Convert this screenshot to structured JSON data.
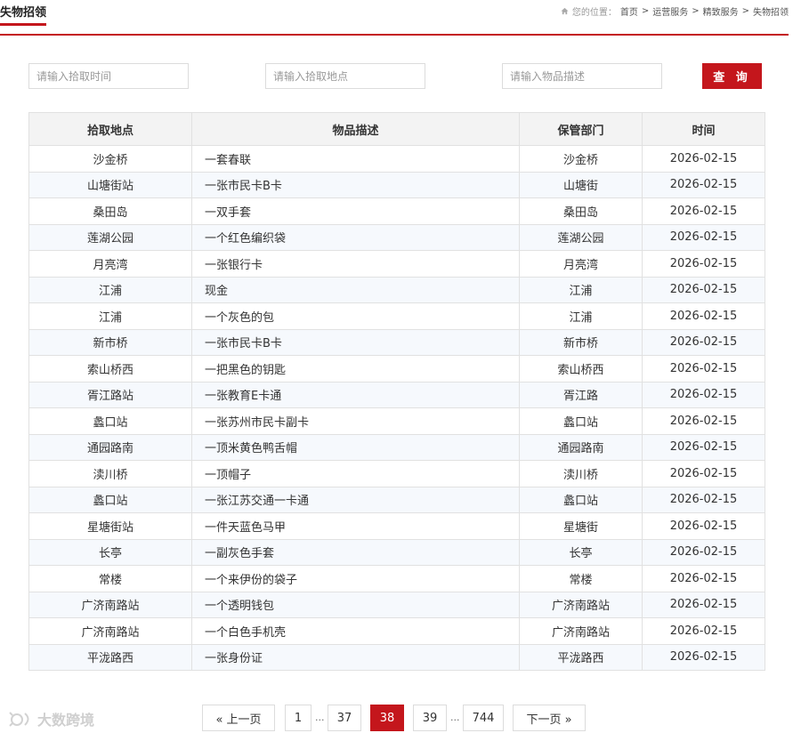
{
  "header": {
    "title": "失物招领",
    "breadcrumb_label": "您的位置：",
    "breadcrumb": [
      "首页",
      "运营服务",
      "精致服务",
      "失物招领"
    ],
    "separator": ">"
  },
  "search": {
    "time_placeholder": "请输入拾取时间",
    "location_placeholder": "请输入拾取地点",
    "description_placeholder": "请输入物品描述",
    "button_label": "查 询"
  },
  "table": {
    "headers": [
      "拾取地点",
      "物品描述",
      "保管部门",
      "时间"
    ],
    "rows": [
      [
        "沙金桥",
        "一套春联",
        "沙金桥",
        "2026-02-15"
      ],
      [
        "山塘街站",
        "一张市民卡B卡",
        "山塘街",
        "2026-02-15"
      ],
      [
        "桑田岛",
        "一双手套",
        "桑田岛",
        "2026-02-15"
      ],
      [
        "莲湖公园",
        "一个红色编织袋",
        "莲湖公园",
        "2026-02-15"
      ],
      [
        "月亮湾",
        "一张银行卡",
        "月亮湾",
        "2026-02-15"
      ],
      [
        "江浦",
        "现金",
        "江浦",
        "2026-02-15"
      ],
      [
        "江浦",
        "一个灰色的包",
        "江浦",
        "2026-02-15"
      ],
      [
        "新市桥",
        "一张市民卡B卡",
        "新市桥",
        "2026-02-15"
      ],
      [
        "索山桥西",
        "一把黑色的钥匙",
        "索山桥西",
        "2026-02-15"
      ],
      [
        "胥江路站",
        "一张教育E卡通",
        "胥江路",
        "2026-02-15"
      ],
      [
        "蠡口站",
        "一张苏州市民卡副卡",
        "蠡口站",
        "2026-02-15"
      ],
      [
        "通园路南",
        "一顶米黄色鸭舌帽",
        "通园路南",
        "2026-02-15"
      ],
      [
        "渎川桥",
        "一顶帽子",
        "渎川桥",
        "2026-02-15"
      ],
      [
        "蠡口站",
        "一张江苏交通一卡通",
        "蠡口站",
        "2026-02-15"
      ],
      [
        "星塘街站",
        "一件天蓝色马甲",
        "星塘街",
        "2026-02-15"
      ],
      [
        "长亭",
        "一副灰色手套",
        "长亭",
        "2026-02-15"
      ],
      [
        "常楼",
        "一个来伊份的袋子",
        "常楼",
        "2026-02-15"
      ],
      [
        "广济南路站",
        "一个透明钱包",
        "广济南路站",
        "2026-02-15"
      ],
      [
        "广济南路站",
        "一个白色手机壳",
        "广济南路站",
        "2026-02-15"
      ],
      [
        "平泷路西",
        "一张身份证",
        "平泷路西",
        "2026-02-15"
      ]
    ]
  },
  "pagination": {
    "prev_label": "« 上一页",
    "next_label": "下一页 »",
    "ellipsis": "...",
    "pages": [
      "1",
      "37",
      "38",
      "39",
      "744"
    ],
    "current": "38"
  },
  "watermark": {
    "text": "大数跨境",
    "icon": "sun-logo-icon"
  },
  "colors": {
    "accent": "#c4161c",
    "header_bg": "#f3f3f3",
    "stripe": "#f6f9fd",
    "border": "#e1e1e1"
  }
}
